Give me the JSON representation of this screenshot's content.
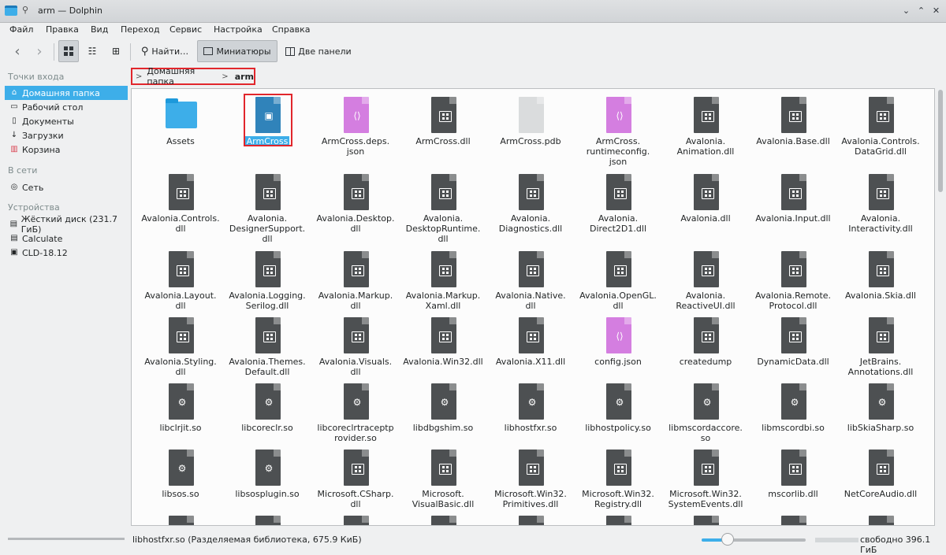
{
  "window": {
    "title": "arm — Dolphin"
  },
  "menu": [
    "Файл",
    "Правка",
    "Вид",
    "Переход",
    "Сервис",
    "Настройка",
    "Справка"
  ],
  "toolbar": {
    "find": "Найти…",
    "preview": "Миниатюры",
    "split": "Две панели"
  },
  "sidebar": {
    "sections": [
      "Точки входа",
      "В сети",
      "Устройства"
    ],
    "places": [
      "Домашняя папка",
      "Рабочий стол",
      "Документы",
      "Загрузки",
      "Корзина"
    ],
    "network": [
      "Сеть"
    ],
    "devices": [
      "Жёсткий диск (231.7 ГиБ)",
      "Calculate",
      "CLD-18.12"
    ]
  },
  "breadcrumb": {
    "parent": "Домашняя папка",
    "current": "arm"
  },
  "files": [
    {
      "name": "Assets",
      "type": "folder"
    },
    {
      "name": "ArmCross",
      "type": "exec",
      "selected": true
    },
    {
      "name": "ArmCross.deps.\njson",
      "type": "json"
    },
    {
      "name": "ArmCross.dll",
      "type": "dll"
    },
    {
      "name": "ArmCross.pdb",
      "type": "pdb"
    },
    {
      "name": "ArmCross.\nruntimeconfig.\njson",
      "type": "json"
    },
    {
      "name": "Avalonia.\nAnimation.dll",
      "type": "dll"
    },
    {
      "name": "Avalonia.Base.dll",
      "type": "dll"
    },
    {
      "name": "Avalonia.Controls.\nDataGrid.dll",
      "type": "dll"
    },
    {
      "name": "Avalonia.Controls.\ndll",
      "type": "dll"
    },
    {
      "name": "Avalonia.\nDesignerSupport.\ndll",
      "type": "dll"
    },
    {
      "name": "Avalonia.Desktop.\ndll",
      "type": "dll"
    },
    {
      "name": "Avalonia.\nDesktopRuntime.\ndll",
      "type": "dll"
    },
    {
      "name": "Avalonia.\nDiagnostics.dll",
      "type": "dll"
    },
    {
      "name": "Avalonia.\nDirect2D1.dll",
      "type": "dll"
    },
    {
      "name": "Avalonia.dll",
      "type": "dll"
    },
    {
      "name": "Avalonia.Input.dll",
      "type": "dll"
    },
    {
      "name": "Avalonia.\nInteractivity.dll",
      "type": "dll"
    },
    {
      "name": "Avalonia.Layout.\ndll",
      "type": "dll"
    },
    {
      "name": "Avalonia.Logging.\nSerilog.dll",
      "type": "dll"
    },
    {
      "name": "Avalonia.Markup.\ndll",
      "type": "dll"
    },
    {
      "name": "Avalonia.Markup.\nXaml.dll",
      "type": "dll"
    },
    {
      "name": "Avalonia.Native.\ndll",
      "type": "dll"
    },
    {
      "name": "Avalonia.OpenGL.\ndll",
      "type": "dll"
    },
    {
      "name": "Avalonia.\nReactiveUI.dll",
      "type": "dll"
    },
    {
      "name": "Avalonia.Remote.\nProtocol.dll",
      "type": "dll"
    },
    {
      "name": "Avalonia.Skia.dll",
      "type": "dll"
    },
    {
      "name": "Avalonia.Styling.\ndll",
      "type": "dll"
    },
    {
      "name": "Avalonia.Themes.\nDefault.dll",
      "type": "dll"
    },
    {
      "name": "Avalonia.Visuals.\ndll",
      "type": "dll"
    },
    {
      "name": "Avalonia.Win32.dll",
      "type": "dll"
    },
    {
      "name": "Avalonia.X11.dll",
      "type": "dll"
    },
    {
      "name": "config.json",
      "type": "json"
    },
    {
      "name": "createdump",
      "type": "dll"
    },
    {
      "name": "DynamicData.dll",
      "type": "dll"
    },
    {
      "name": "JetBrains.\nAnnotations.dll",
      "type": "dll"
    },
    {
      "name": "libclrjit.so",
      "type": "so"
    },
    {
      "name": "libcoreclr.so",
      "type": "so"
    },
    {
      "name": "libcoreclrtraceptp\nrovider.so",
      "type": "so"
    },
    {
      "name": "libdbgshim.so",
      "type": "so"
    },
    {
      "name": "libhostfxr.so",
      "type": "so"
    },
    {
      "name": "libhostpolicy.so",
      "type": "so"
    },
    {
      "name": "libmscordaccore.\nso",
      "type": "so"
    },
    {
      "name": "libmscordbi.so",
      "type": "so"
    },
    {
      "name": "libSkiaSharp.so",
      "type": "so"
    },
    {
      "name": "libsos.so",
      "type": "so"
    },
    {
      "name": "libsosplugin.so",
      "type": "so"
    },
    {
      "name": "Microsoft.CSharp.\ndll",
      "type": "dll"
    },
    {
      "name": "Microsoft.\nVisualBasic.dll",
      "type": "dll"
    },
    {
      "name": "Microsoft.Win32.\nPrimitives.dll",
      "type": "dll"
    },
    {
      "name": "Microsoft.Win32.\nRegistry.dll",
      "type": "dll"
    },
    {
      "name": "Microsoft.Win32.\nSystemEvents.dll",
      "type": "dll"
    },
    {
      "name": "mscorlib.dll",
      "type": "dll"
    },
    {
      "name": "NetCoreAudio.dll",
      "type": "dll"
    }
  ],
  "partial_row_types": [
    "dll",
    "dll",
    "dll",
    "dll",
    "dll",
    "dll",
    "dll",
    "dll",
    "dll"
  ],
  "status": {
    "text": "libhostfxr.so (Разделяемая библиотека, 675.9 КиБ)",
    "zoom_fraction": 0.25,
    "free_space": "свободно 396.1 ГиБ"
  },
  "colors": {
    "accent": "#3daee9",
    "highlight_box": "#e1262c"
  }
}
